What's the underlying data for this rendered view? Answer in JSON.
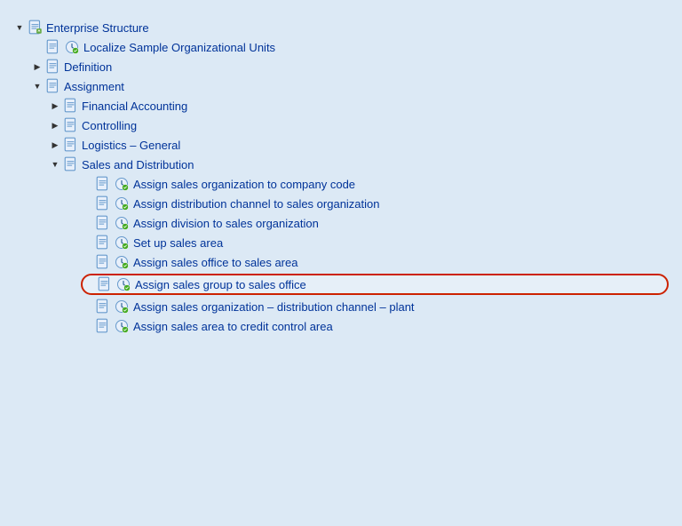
{
  "tree": {
    "root": {
      "label": "Enterprise Structure",
      "expanded": true,
      "children": [
        {
          "label": "Localize Sample Organizational Units",
          "hasClock": true,
          "expanded": false,
          "children": []
        },
        {
          "label": "Definition",
          "expanded": false,
          "hasToggle": true,
          "children": []
        },
        {
          "label": "Assignment",
          "expanded": true,
          "hasToggle": true,
          "children": [
            {
              "label": "Financial Accounting",
              "expanded": false,
              "hasToggle": true,
              "children": []
            },
            {
              "label": "Controlling",
              "expanded": false,
              "hasToggle": true,
              "children": []
            },
            {
              "label": "Logistics – General",
              "expanded": false,
              "hasToggle": true,
              "children": []
            },
            {
              "label": "Sales and Distribution",
              "expanded": true,
              "hasToggle": true,
              "children": [
                {
                  "label": "Assign sales organization to company code",
                  "hasClock": true
                },
                {
                  "label": "Assign distribution channel to sales organization",
                  "hasClock": true
                },
                {
                  "label": "Assign division to sales organization",
                  "hasClock": true
                },
                {
                  "label": "Set up sales area",
                  "hasClock": true
                },
                {
                  "label": "Assign sales office to sales area",
                  "hasClock": true
                },
                {
                  "label": "Assign sales group to sales office",
                  "hasClock": true,
                  "highlighted": true
                },
                {
                  "label": "Assign sales organization – distribution channel – plant",
                  "hasClock": true
                },
                {
                  "label": "Assign sales area to credit control area",
                  "hasClock": true
                }
              ]
            }
          ]
        }
      ]
    }
  }
}
